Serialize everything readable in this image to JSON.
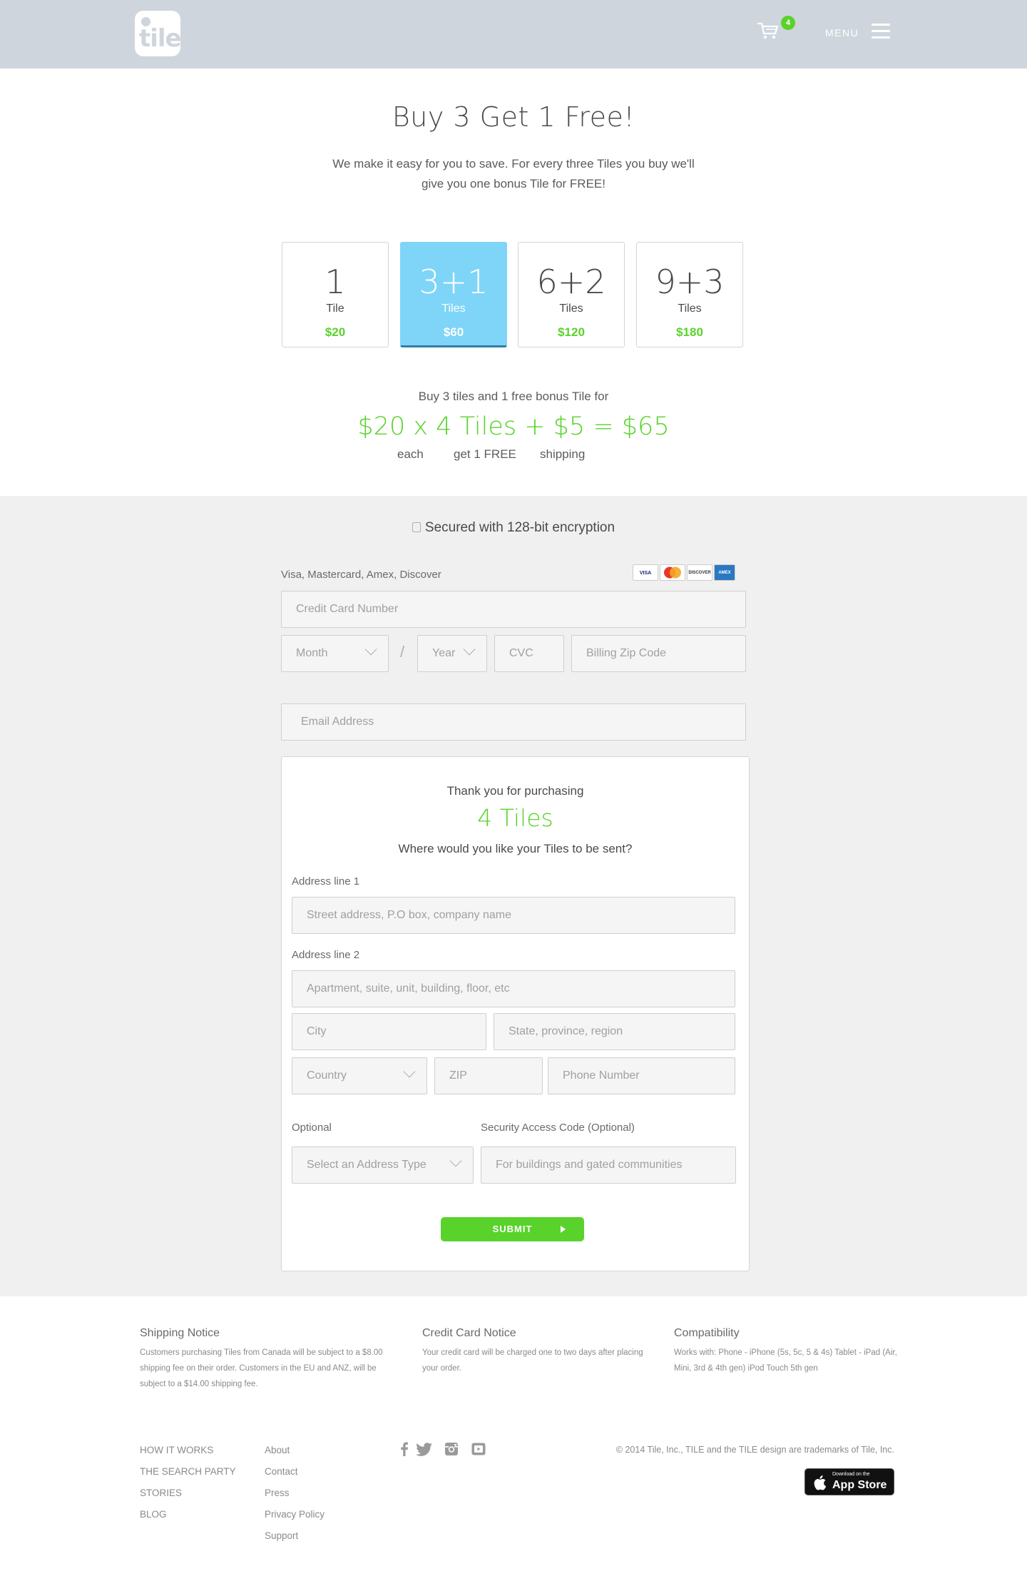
{
  "header": {
    "logo_text": "tile",
    "cart_count": "4",
    "menu_label": "MENU"
  },
  "hero": {
    "title": "Buy 3 Get 1 Free!",
    "subtitle": "We make it easy for you to save. For every three Tiles you buy we'll give you one bonus Tile for FREE!"
  },
  "packs": [
    {
      "count": "1",
      "unit": "Tile",
      "price": "$20",
      "selected": false
    },
    {
      "count": "3+1",
      "unit": "Tiles",
      "price": "$60",
      "selected": true
    },
    {
      "count": "6+2",
      "unit": "Tiles",
      "price": "$120",
      "selected": false
    },
    {
      "count": "9+3",
      "unit": "Tiles",
      "price": "$180",
      "selected": false
    }
  ],
  "calc": {
    "lead": "Buy 3 tiles and 1 free bonus Tile for",
    "equation": "$20 x 4 Tiles + $5 = $65",
    "label_each": "each",
    "label_free": "get 1 FREE",
    "label_shipping": "shipping"
  },
  "payment": {
    "secure_text": "Secured with 128-bit encryption",
    "cards_label": "Visa, Mastercard, Amex, Discover",
    "card_logos": [
      "VISA",
      "MasterCard",
      "DISCOVER",
      "AMEX"
    ],
    "card_number_placeholder": "Credit Card Number",
    "month_placeholder": "Month",
    "separator": "/",
    "year_placeholder": "Year",
    "cvc_placeholder": "CVC",
    "zip_placeholder": "Billing Zip Code",
    "email_placeholder": "Email Address"
  },
  "shipping": {
    "thanks": "Thank you for purchasing",
    "count": "4 Tiles",
    "question": "Where would you like your Tiles to be sent?",
    "address1_label": "Address line 1",
    "address1_placeholder": "Street address, P.O box, company name",
    "address2_label": "Address line 2",
    "address2_placeholder": "Apartment, suite, unit, building, floor, etc",
    "city_placeholder": "City",
    "state_placeholder": "State, province, region",
    "country_placeholder": "Country",
    "zip_placeholder": "ZIP",
    "phone_placeholder": "Phone Number",
    "optional_label": "Optional",
    "access_label": "Security Access Code (Optional)",
    "address_type_placeholder": "Select an Address Type",
    "access_placeholder": "For buildings and gated communities",
    "submit_label": "SUBMIT"
  },
  "footer": {
    "shipping_notice_title": "Shipping Notice",
    "shipping_notice_text": "Customers purchasing Tiles from Canada will be subject to a $8.00 shipping fee on their order. Customers in the EU and ANZ, will be subject to a $14.00 shipping fee.",
    "card_notice_title": "Credit Card Notice",
    "card_notice_text": "Your credit card will be charged one to two days after placing your order.",
    "compat_title": "Compatibility",
    "compat_text": "Works with: Phone - iPhone (5s, 5c, 5 & 4s) Tablet - iPad (Air, Mini, 3rd & 4th gen) iPod Touch 5th gen",
    "nav_primary": [
      "HOW IT WORKS",
      "THE SEARCH PARTY",
      "STORIES",
      "BLOG"
    ],
    "nav_secondary": [
      "About",
      "Contact",
      "Press",
      "Privacy Policy",
      "Support"
    ],
    "social_icons": [
      "facebook-icon",
      "twitter-icon",
      "instagram-icon",
      "youtube-icon"
    ],
    "copyright": "© 2014 Tile, Inc., TILE and the TILE design are trademarks of Tile, Inc.",
    "appstore_small": "Download on the",
    "appstore_big": "App Store"
  }
}
